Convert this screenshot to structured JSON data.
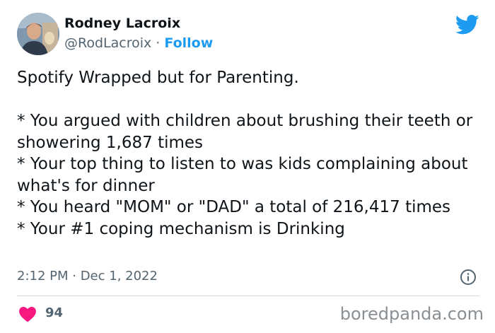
{
  "author": {
    "name": "Rodney Lacroix",
    "handle": "@RodLacroix",
    "separator": "·",
    "follow_label": "Follow"
  },
  "tweet": {
    "headline": "Spotify Wrapped but for Parenting.",
    "lines": [
      "* You argued with children about brushing their teeth or showering 1,687 times",
      "* Your top thing to listen to was kids complaining about what's for dinner",
      "* You heard \"MOM\" or \"DAD\" a total of 216,417 times",
      "* Your #1 coping mechanism is Drinking"
    ],
    "timestamp": "2:12 PM · Dec 1, 2022",
    "like_count": "94"
  },
  "icons": {
    "brand": "twitter-bird-icon",
    "info": "info-icon",
    "like": "heart-icon"
  },
  "watermark": "boredpanda.com",
  "colors": {
    "twitter_blue": "#1d9bf0",
    "heart_pink": "#f91880",
    "secondary_text": "#536471",
    "divider": "#cfd9de"
  }
}
